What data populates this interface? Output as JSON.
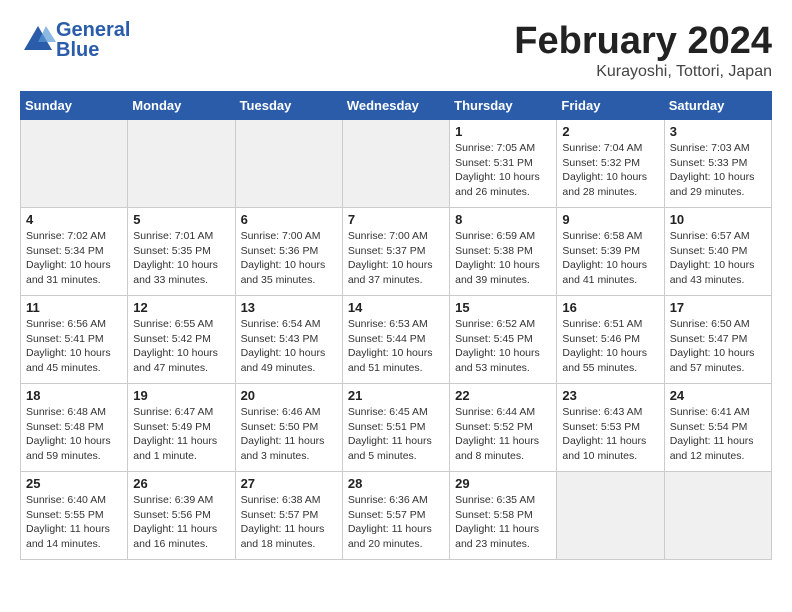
{
  "logo": {
    "general": "General",
    "blue": "Blue"
  },
  "title": {
    "month": "February 2024",
    "location": "Kurayoshi, Tottori, Japan"
  },
  "headers": [
    "Sunday",
    "Monday",
    "Tuesday",
    "Wednesday",
    "Thursday",
    "Friday",
    "Saturday"
  ],
  "weeks": [
    [
      {
        "day": "",
        "sunrise": "",
        "sunset": "",
        "daylight": ""
      },
      {
        "day": "",
        "sunrise": "",
        "sunset": "",
        "daylight": ""
      },
      {
        "day": "",
        "sunrise": "",
        "sunset": "",
        "daylight": ""
      },
      {
        "day": "",
        "sunrise": "",
        "sunset": "",
        "daylight": ""
      },
      {
        "day": "1",
        "sunrise": "Sunrise: 7:05 AM",
        "sunset": "Sunset: 5:31 PM",
        "daylight": "Daylight: 10 hours and 26 minutes."
      },
      {
        "day": "2",
        "sunrise": "Sunrise: 7:04 AM",
        "sunset": "Sunset: 5:32 PM",
        "daylight": "Daylight: 10 hours and 28 minutes."
      },
      {
        "day": "3",
        "sunrise": "Sunrise: 7:03 AM",
        "sunset": "Sunset: 5:33 PM",
        "daylight": "Daylight: 10 hours and 29 minutes."
      }
    ],
    [
      {
        "day": "4",
        "sunrise": "Sunrise: 7:02 AM",
        "sunset": "Sunset: 5:34 PM",
        "daylight": "Daylight: 10 hours and 31 minutes."
      },
      {
        "day": "5",
        "sunrise": "Sunrise: 7:01 AM",
        "sunset": "Sunset: 5:35 PM",
        "daylight": "Daylight: 10 hours and 33 minutes."
      },
      {
        "day": "6",
        "sunrise": "Sunrise: 7:00 AM",
        "sunset": "Sunset: 5:36 PM",
        "daylight": "Daylight: 10 hours and 35 minutes."
      },
      {
        "day": "7",
        "sunrise": "Sunrise: 7:00 AM",
        "sunset": "Sunset: 5:37 PM",
        "daylight": "Daylight: 10 hours and 37 minutes."
      },
      {
        "day": "8",
        "sunrise": "Sunrise: 6:59 AM",
        "sunset": "Sunset: 5:38 PM",
        "daylight": "Daylight: 10 hours and 39 minutes."
      },
      {
        "day": "9",
        "sunrise": "Sunrise: 6:58 AM",
        "sunset": "Sunset: 5:39 PM",
        "daylight": "Daylight: 10 hours and 41 minutes."
      },
      {
        "day": "10",
        "sunrise": "Sunrise: 6:57 AM",
        "sunset": "Sunset: 5:40 PM",
        "daylight": "Daylight: 10 hours and 43 minutes."
      }
    ],
    [
      {
        "day": "11",
        "sunrise": "Sunrise: 6:56 AM",
        "sunset": "Sunset: 5:41 PM",
        "daylight": "Daylight: 10 hours and 45 minutes."
      },
      {
        "day": "12",
        "sunrise": "Sunrise: 6:55 AM",
        "sunset": "Sunset: 5:42 PM",
        "daylight": "Daylight: 10 hours and 47 minutes."
      },
      {
        "day": "13",
        "sunrise": "Sunrise: 6:54 AM",
        "sunset": "Sunset: 5:43 PM",
        "daylight": "Daylight: 10 hours and 49 minutes."
      },
      {
        "day": "14",
        "sunrise": "Sunrise: 6:53 AM",
        "sunset": "Sunset: 5:44 PM",
        "daylight": "Daylight: 10 hours and 51 minutes."
      },
      {
        "day": "15",
        "sunrise": "Sunrise: 6:52 AM",
        "sunset": "Sunset: 5:45 PM",
        "daylight": "Daylight: 10 hours and 53 minutes."
      },
      {
        "day": "16",
        "sunrise": "Sunrise: 6:51 AM",
        "sunset": "Sunset: 5:46 PM",
        "daylight": "Daylight: 10 hours and 55 minutes."
      },
      {
        "day": "17",
        "sunrise": "Sunrise: 6:50 AM",
        "sunset": "Sunset: 5:47 PM",
        "daylight": "Daylight: 10 hours and 57 minutes."
      }
    ],
    [
      {
        "day": "18",
        "sunrise": "Sunrise: 6:48 AM",
        "sunset": "Sunset: 5:48 PM",
        "daylight": "Daylight: 10 hours and 59 minutes."
      },
      {
        "day": "19",
        "sunrise": "Sunrise: 6:47 AM",
        "sunset": "Sunset: 5:49 PM",
        "daylight": "Daylight: 11 hours and 1 minute."
      },
      {
        "day": "20",
        "sunrise": "Sunrise: 6:46 AM",
        "sunset": "Sunset: 5:50 PM",
        "daylight": "Daylight: 11 hours and 3 minutes."
      },
      {
        "day": "21",
        "sunrise": "Sunrise: 6:45 AM",
        "sunset": "Sunset: 5:51 PM",
        "daylight": "Daylight: 11 hours and 5 minutes."
      },
      {
        "day": "22",
        "sunrise": "Sunrise: 6:44 AM",
        "sunset": "Sunset: 5:52 PM",
        "daylight": "Daylight: 11 hours and 8 minutes."
      },
      {
        "day": "23",
        "sunrise": "Sunrise: 6:43 AM",
        "sunset": "Sunset: 5:53 PM",
        "daylight": "Daylight: 11 hours and 10 minutes."
      },
      {
        "day": "24",
        "sunrise": "Sunrise: 6:41 AM",
        "sunset": "Sunset: 5:54 PM",
        "daylight": "Daylight: 11 hours and 12 minutes."
      }
    ],
    [
      {
        "day": "25",
        "sunrise": "Sunrise: 6:40 AM",
        "sunset": "Sunset: 5:55 PM",
        "daylight": "Daylight: 11 hours and 14 minutes."
      },
      {
        "day": "26",
        "sunrise": "Sunrise: 6:39 AM",
        "sunset": "Sunset: 5:56 PM",
        "daylight": "Daylight: 11 hours and 16 minutes."
      },
      {
        "day": "27",
        "sunrise": "Sunrise: 6:38 AM",
        "sunset": "Sunset: 5:57 PM",
        "daylight": "Daylight: 11 hours and 18 minutes."
      },
      {
        "day": "28",
        "sunrise": "Sunrise: 6:36 AM",
        "sunset": "Sunset: 5:57 PM",
        "daylight": "Daylight: 11 hours and 20 minutes."
      },
      {
        "day": "29",
        "sunrise": "Sunrise: 6:35 AM",
        "sunset": "Sunset: 5:58 PM",
        "daylight": "Daylight: 11 hours and 23 minutes."
      },
      {
        "day": "",
        "sunrise": "",
        "sunset": "",
        "daylight": ""
      },
      {
        "day": "",
        "sunrise": "",
        "sunset": "",
        "daylight": ""
      }
    ]
  ]
}
